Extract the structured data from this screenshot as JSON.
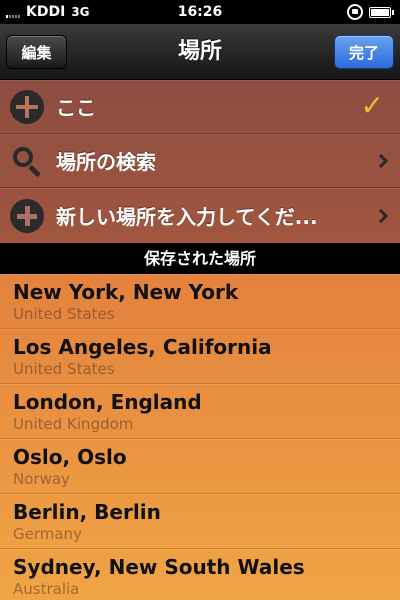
{
  "status_bar": {
    "carrier": "KDDI",
    "network": "3G",
    "time": "16:26"
  },
  "nav": {
    "title": "場所",
    "edit_label": "編集",
    "done_label": "完了"
  },
  "top_rows": [
    {
      "label": "ここ",
      "icon": "location-icon",
      "accessory": "checkmark"
    },
    {
      "label": "場所の検索",
      "icon": "search-icon",
      "accessory": "chevron"
    },
    {
      "label": "新しい場所を入力してくだ...",
      "icon": "add-icon",
      "accessory": "chevron"
    }
  ],
  "section_header": "保存された場所",
  "saved_places": [
    {
      "name": "New York, New York",
      "country": "United States"
    },
    {
      "name": "Los Angeles, California",
      "country": "United States"
    },
    {
      "name": "London, England",
      "country": "United Kingdom"
    },
    {
      "name": "Oslo, Oslo",
      "country": "Norway"
    },
    {
      "name": "Berlin, Berlin",
      "country": "Germany"
    },
    {
      "name": "Sydney, New South Wales",
      "country": "Australia"
    }
  ],
  "colors": {
    "checkmark": "#f7b733",
    "done_button": "#2a6bdc",
    "saved_list_bg": "#e38a3a"
  }
}
